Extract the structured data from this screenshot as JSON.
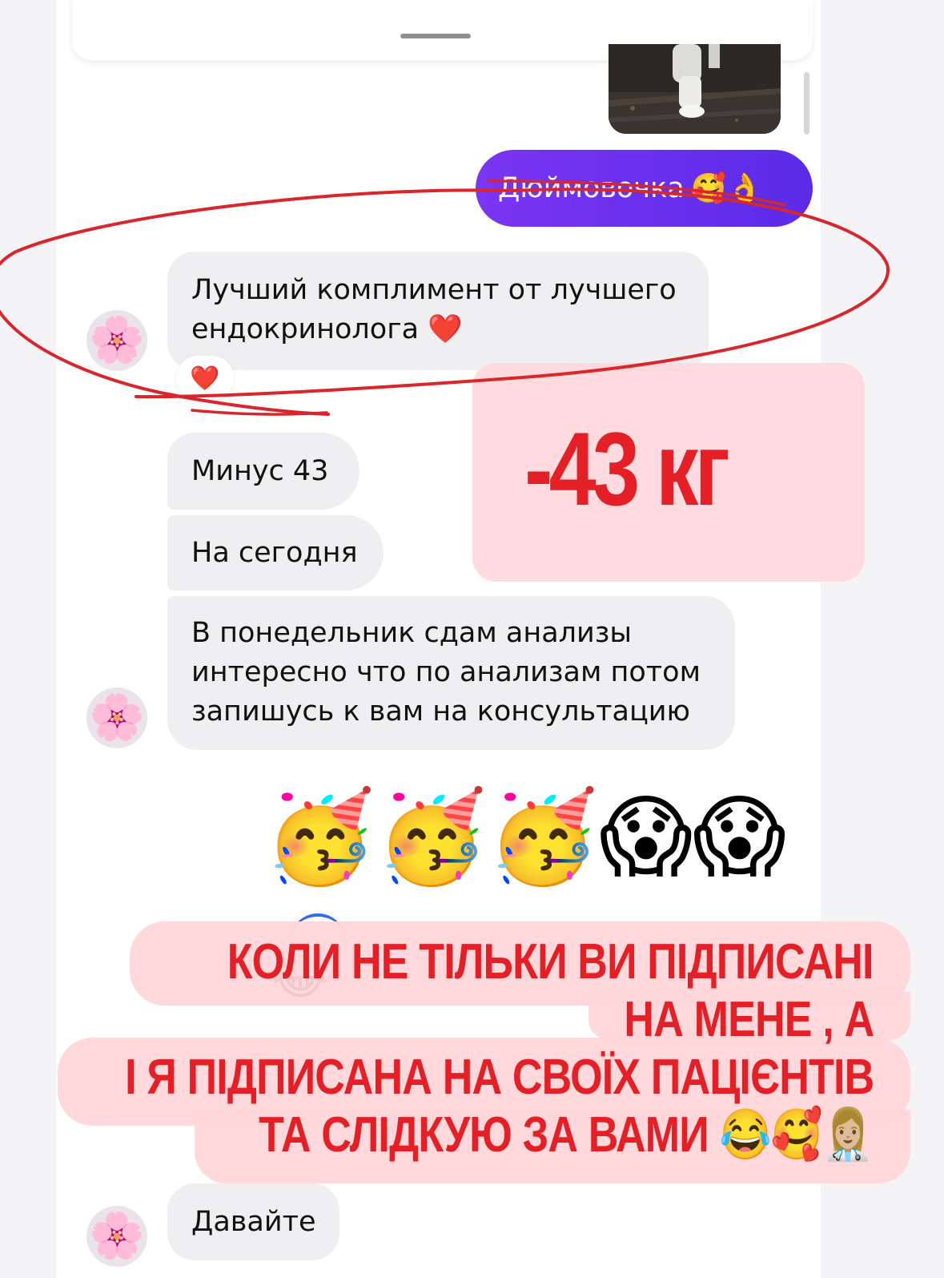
{
  "chat": {
    "outgoing_message": "Дюймовочка",
    "outgoing_emojis": "🥰👌",
    "messages": [
      {
        "line1": "Лучший комплимент от лучшего",
        "line2": "ендокринолога ❤️"
      },
      {
        "text": "Минус 43"
      },
      {
        "text": "На сегодня"
      },
      {
        "line1": "В понедельник сдам анализы",
        "line2": "интересно что по анализам потом",
        "line3": "запишусь к вам на консультацию"
      },
      {
        "text": "Давайте"
      }
    ],
    "reaction": "❤️",
    "avatar_emoji": "🌸",
    "reaction_emojis": "🥳🥳🥳😱😱",
    "partial_emoji": "😂"
  },
  "overlay": {
    "weight_label": "-43 кг",
    "caption_lines": [
      "КОЛИ НЕ ТІЛЬКИ  ВИ ПІДПИСАНІ",
      "НА МЕНЕ , А",
      "І Я ПІДПИСАНА НА СВОЇХ ПАЦІЄНТІВ",
      "ТА СЛІДКУЮ ЗА ВАМИ 😂🥰👩🏼‍⚕️"
    ]
  },
  "colors": {
    "outgoing_bubble": "#6431ee",
    "incoming_bubble": "#efeff1",
    "overlay_text": "#e41f26",
    "overlay_box": "#ffd7db",
    "annotation_stroke": "#d8262c"
  },
  "icons": [
    "heart-icon",
    "flower-avatar-icon",
    "drag-handle"
  ]
}
